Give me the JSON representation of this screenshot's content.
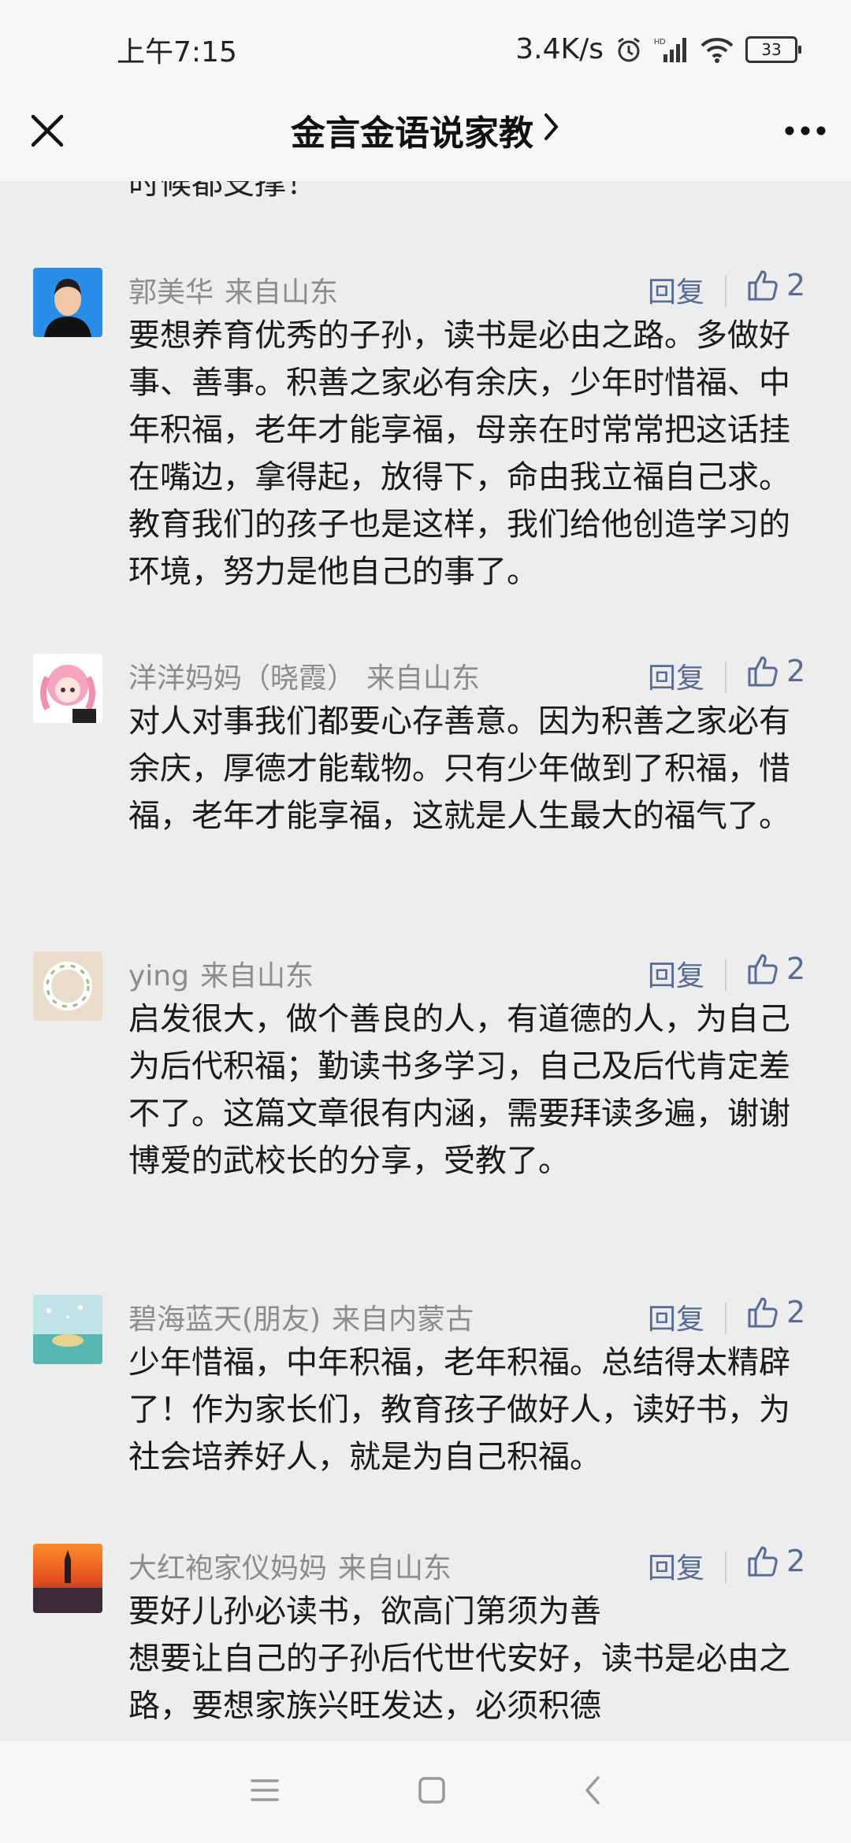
{
  "status_bar": {
    "time": "上午7:15",
    "network_speed": "3.4K/s",
    "battery": "33",
    "icons": [
      "alarm-icon",
      "hd-signal-icon",
      "wifi-icon",
      "battery-icon"
    ]
  },
  "header": {
    "title": "金言金语说家教",
    "icons": [
      "close-icon",
      "chevron-right-icon",
      "more-icon"
    ]
  },
  "partial_top_text": "时候都支撑！",
  "comments": [
    {
      "name": "郭美华",
      "region": "来自山东",
      "reply": "回复",
      "likes": "2",
      "text": "要想养育优秀的子孙，读书是必由之路。多做好事、善事。积善之家必有余庆，少年时惜福、中年积福，老年才能享福，母亲在时常常把这话挂在嘴边，拿得起，放得下，命由我立福自己求。教育我们的孩子也是这样，我们给他创造学习的环境，努力是他自己的事了。"
    },
    {
      "name": "洋洋妈妈（晓霞）",
      "region": "来自山东",
      "reply": "回复",
      "likes": "2",
      "text": "对人对事我们都要心存善意。因为积善之家必有余庆，厚德才能载物。只有少年做到了积福，惜福，老年才能享福，这就是人生最大的福气了。"
    },
    {
      "name": "ying",
      "region": "来自山东",
      "reply": "回复",
      "likes": "2",
      "text": "启发很大，做个善良的人，有道德的人，为自己为后代积福；勤读书多学习，自己及后代肯定差不了。这篇文章很有内涵，需要拜读多遍，谢谢博爱的武校长的分享，受教了。"
    },
    {
      "name": "碧海蓝天(朋友)",
      "region": "来自内蒙古",
      "reply": "回复",
      "likes": "2",
      "text": "少年惜福，中年积福，老年积福。总结得太精辟了！作为家长们，教育孩子做好人，读好书，为社会培养好人，就是为自己积福。"
    },
    {
      "name": "大红袍家仪妈妈",
      "region": "来自山东",
      "reply": "回复",
      "likes": "2",
      "text": "要好儿孙必读书，欲高门第须为善\n想要让自己的子孙后代世代安好，读书是必由之路，要想家族兴旺发达，必须积德"
    }
  ],
  "nav_bar": {
    "icons": [
      "menu-icon",
      "home-icon",
      "back-icon"
    ]
  }
}
